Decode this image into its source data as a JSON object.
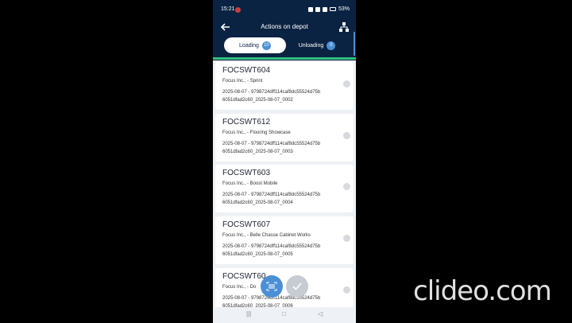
{
  "status": {
    "time": "15:21",
    "battery": "53%"
  },
  "header": {
    "title": "Actions on depot"
  },
  "tabs": [
    {
      "label": "Loading",
      "count": "10"
    },
    {
      "label": "Unloading",
      "count": "0"
    }
  ],
  "items": [
    {
      "title": "FOCSWT604",
      "subtitle": "Focus Inc., - Sprint",
      "ref": "2025-08-07 - 9798724dff114caf8dc55524d75b 6051dfad2c60_2025-08-07_0002"
    },
    {
      "title": "FOCSWT612",
      "subtitle": "Focus Inc., - Flooring Showcase",
      "ref": "2025-08-07 - 9798724dff114caf8dc55524d75b 6051dfad2c60_2025-08-07_0003"
    },
    {
      "title": "FOCSWT603",
      "subtitle": "Focus Inc., - Boost Mobile",
      "ref": "2025-08-07 - 9798724dff114caf8dc55524d75b 6051dfad2c60_2025-08-07_0004"
    },
    {
      "title": "FOCSWT607",
      "subtitle": "Focus Inc., - Belle Chasse Cabinet Works",
      "ref": "2025-08-07 - 9798724dff114caf8dc55524d75b 6051dfad2c60_2025-08-07_0005"
    },
    {
      "title": "FOCSWT60",
      "subtitle": "Focus Inc., - Do",
      "ref": "2025-08-07 - 9798724dff114caf8dc55524d75b 6051dfad2c60_2025-08-07_0006"
    }
  ],
  "watermark": "clideo.com",
  "colors": {
    "appbar": "#0b2342",
    "accent": "#4b8fd6",
    "green": "#33c07d"
  },
  "icons": {
    "back": "arrow-left-icon",
    "tree": "hierarchy-icon",
    "scan": "barcode-scan-icon",
    "confirm": "check-icon"
  }
}
